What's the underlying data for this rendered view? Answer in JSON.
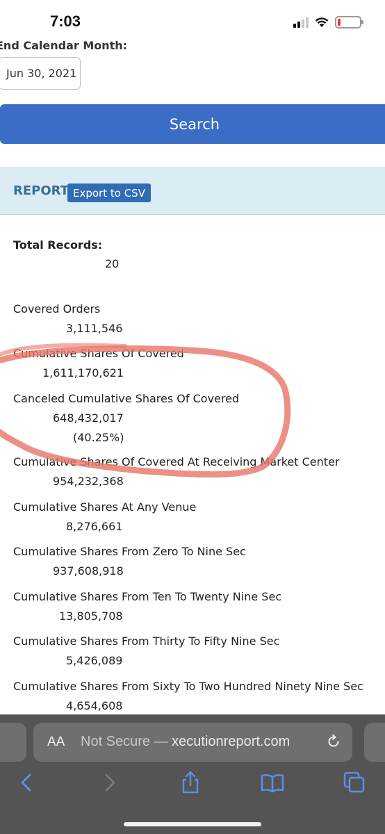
{
  "status": {
    "time": "7:03"
  },
  "form": {
    "end_label": "End Calendar Month:",
    "end_value": "Jun 30, 2021",
    "search_label": "Search"
  },
  "report": {
    "title": "REPORT",
    "export_label": "Export to CSV",
    "total_records_label": "Total Records:",
    "total_records_value": "20",
    "rows": [
      {
        "label": "Covered Orders",
        "value": "3,111,546"
      },
      {
        "label": "Cumulative Shares Of Covered",
        "value": "1,611,170,621"
      },
      {
        "label": "Canceled Cumulative Shares Of Covered",
        "value": "648,432,017",
        "extra": "(40.25%)"
      },
      {
        "label": "Cumulative Shares Of Covered At Receiving Market Center",
        "value": "954,232,368"
      },
      {
        "label": "Cumulative Shares At Any Venue",
        "value": "8,276,661"
      },
      {
        "label": "Cumulative Shares From Zero To Nine Sec",
        "value": "937,608,918"
      },
      {
        "label": "Cumulative Shares From Ten To Twenty Nine Sec",
        "value": "13,805,708"
      },
      {
        "label": "Cumulative Shares From Thirty To Fifty Nine Sec",
        "value": "5,426,089"
      },
      {
        "label": "Cumulative Shares From Sixty To Two Hundred Ninety Nine Sec",
        "value": "4,654,608"
      }
    ]
  },
  "browser": {
    "aa_label": "AA",
    "url_prefix": "Not Secure —",
    "url_domain": "xecutionreport.com"
  },
  "icons": {
    "back": "chevron-left-icon",
    "forward": "chevron-right-icon",
    "share": "share-icon",
    "bookmarks": "book-icon",
    "tabs": "tabs-icon",
    "reload": "reload-icon"
  },
  "colors": {
    "search_button": "#3b6cc6",
    "report_header_bg": "#dcecf4",
    "export_button": "#2f6cb6",
    "annotation": "#e8776a",
    "toolbar_icons": "#5b8fe6"
  }
}
